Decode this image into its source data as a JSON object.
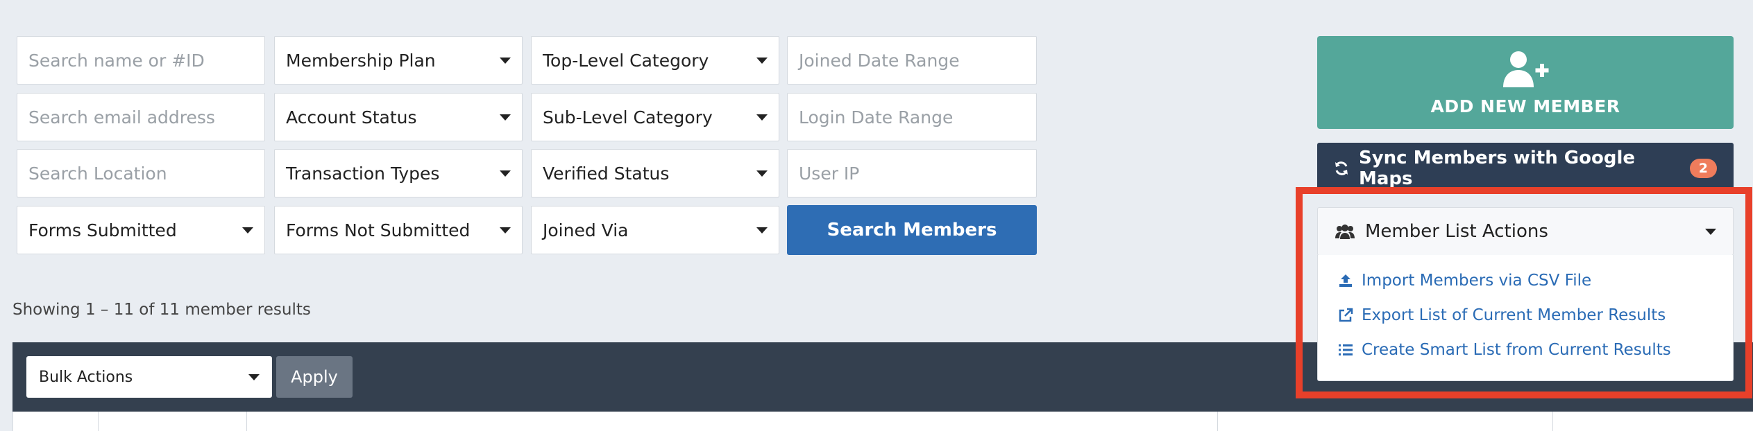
{
  "filters": {
    "row1": {
      "search_name_placeholder": "Search name or #ID",
      "membership_plan": "Membership Plan",
      "top_level_category": "Top-Level Category",
      "joined_date_range_placeholder": "Joined Date Range"
    },
    "row2": {
      "search_email_placeholder": "Search email address",
      "account_status": "Account Status",
      "sub_level_category": "Sub-Level Category",
      "login_date_range_placeholder": "Login Date Range"
    },
    "row3": {
      "search_location_placeholder": "Search Location",
      "transaction_types": "Transaction Types",
      "verified_status": "Verified Status",
      "user_ip_placeholder": "User IP"
    },
    "row4": {
      "forms_submitted": "Forms Submitted",
      "forms_not_submitted": "Forms Not Submitted",
      "joined_via": "Joined Via",
      "search_button": "Search Members"
    }
  },
  "results_text": "Showing 1 – 11 of 11 member results",
  "bulk": {
    "select_value": "Bulk Actions",
    "apply_label": "Apply"
  },
  "sidebar": {
    "add_member_label": "ADD NEW MEMBER",
    "add_member_icon": "user-plus-icon",
    "sync_label": "Sync Members with Google Maps",
    "sync_icon": "refresh-icon",
    "sync_badge": "2",
    "actions_label": "Member List Actions",
    "actions_icon": "users-icon",
    "menu": [
      {
        "label": "Import Members via CSV File",
        "icon": "upload-icon"
      },
      {
        "label": "Export List of Current Member Results",
        "icon": "external-link-icon"
      },
      {
        "label": "Create Smart List from Current Results",
        "icon": "list-icon"
      }
    ]
  },
  "colors": {
    "add_button": "#54a79a",
    "sync_button": "#2e3e55",
    "badge": "#ef7c5c",
    "search_button": "#2e6db4",
    "highlight": "#e8402a",
    "link": "#2a6bb5"
  }
}
